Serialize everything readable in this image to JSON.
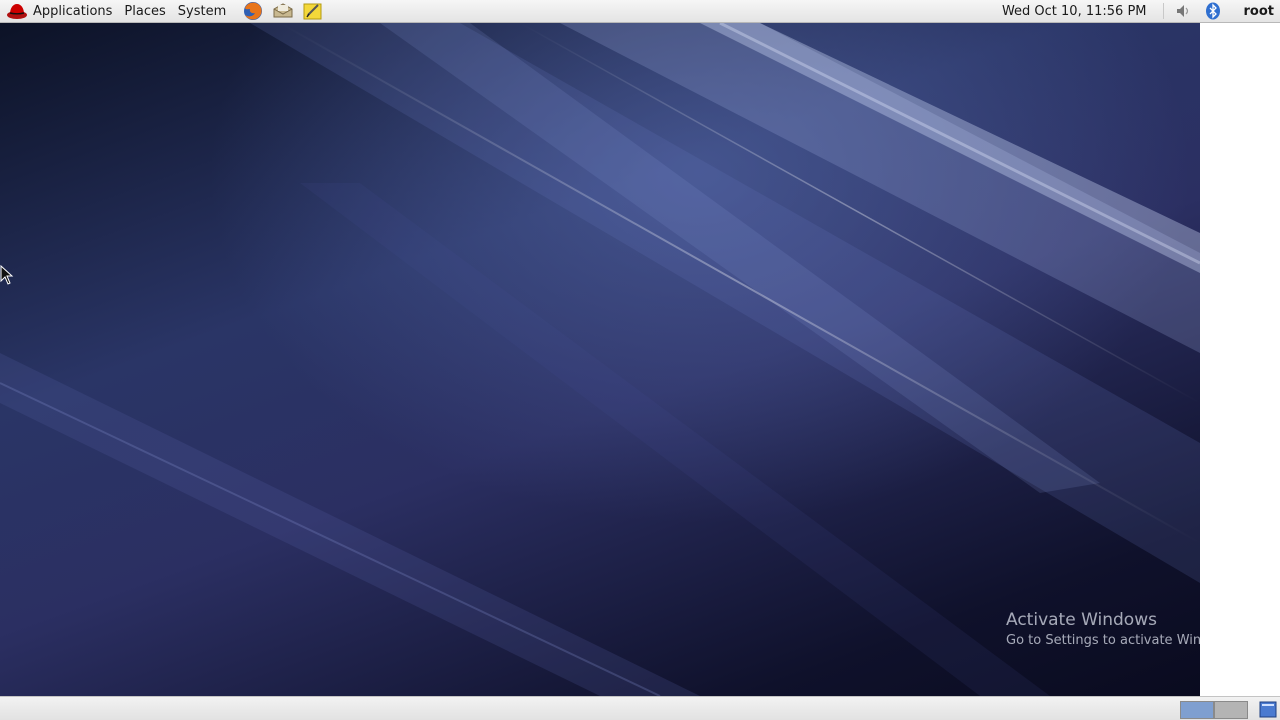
{
  "top_panel": {
    "menus": [
      {
        "label": "Applications"
      },
      {
        "label": "Places"
      },
      {
        "label": "System"
      }
    ],
    "launchers": [
      "firefox-icon",
      "mail-icon",
      "notes-icon"
    ],
    "clock": "Wed Oct 10, 11:56 PM",
    "tray": [
      "volume-icon",
      "bluetooth-icon"
    ],
    "user": "root"
  },
  "watermark": {
    "title": "Activate Windows",
    "subtitle": "Go to Settings to activate Windows."
  },
  "bottom_panel": {
    "workspaces": 2,
    "active_workspace": 1
  },
  "colors": {
    "panel": "#e8e8e8",
    "desktop_dark": "#0c1226",
    "desktop_light": "#4a5a9a",
    "workspace_active": "#7f9fd0"
  }
}
